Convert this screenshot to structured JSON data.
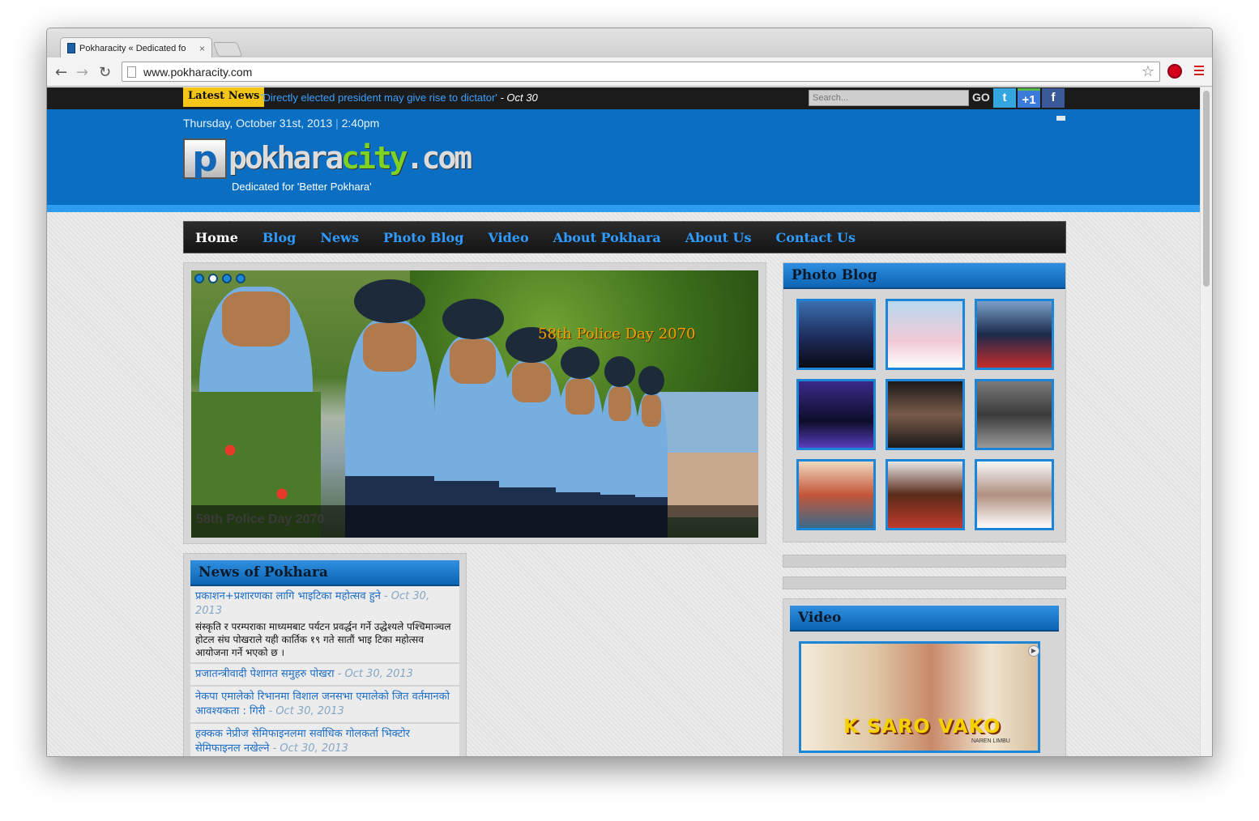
{
  "browser": {
    "tab_title": "Pokharacity « Dedicated fo",
    "tab_close": "×",
    "url": "www.pokharacity.com",
    "back": "←",
    "forward": "→",
    "reload": "↻",
    "star": "☆"
  },
  "topbar": {
    "latest_label": "Latest News",
    "latest_headline": "'Directly elected president may give rise to dictator'",
    "latest_date": "- Oct 30",
    "search_placeholder": "Search...",
    "go_label": "GO",
    "twitter": "t",
    "gplus": "+1",
    "facebook": "f"
  },
  "header": {
    "date": "Thursday, October 31st, 2013",
    "separator": "|",
    "time": "2:40pm",
    "logo_letter": "p",
    "logo_part1": "pokhara",
    "logo_part2": "city",
    "logo_part3": ".com",
    "tagline": "Dedicated for 'Better Pokhara'"
  },
  "nav": {
    "items": [
      "Home",
      "Blog",
      "News",
      "Photo Blog",
      "Video",
      "About Pokhara",
      "About Us",
      "Contact Us"
    ],
    "active": "Home"
  },
  "slider": {
    "overlay_title": "58th Police Day 2070",
    "caption": "58th Police Day 2070"
  },
  "photo_blog": {
    "title": "Photo Blog"
  },
  "video": {
    "title": "Video",
    "thumb_title": "K SARO VAKO",
    "thumb_sub": "NAREN LIMBU"
  },
  "news": {
    "title": "News of Pokhara",
    "items": [
      {
        "title": "प्रकाशन+प्रशारणका लागि भाइटिका महोत्सव हुने",
        "date": "- Oct 30, 2013",
        "excerpt": "संस्कृति र परम्पराका माध्यमबाट पर्यटन प्रवर्द्धन गर्ने उद्धेश्यले पश्चिमाञ्चल होटल संघ पोखराले यही कार्तिक १९ गते सातौं भाइ टिका महोत्सव आयोजना गर्ने भएको छ ।"
      },
      {
        "title": "प्रजातन्त्रीवादी पेशागत समुहरु पोखरा",
        "date": "- Oct 30, 2013"
      },
      {
        "title": "नेकपा एमालेको रिभानमा विशाल जनसभा एमालेको जित वर्तमानको आवश्यकता : गिरी",
        "date": "- Oct 30, 2013"
      },
      {
        "title": "हक्कक नेप्रीज सेमिफाइनलमा सर्वाधिक गोलकर्ता भिक्टोर सेमिफाइनल नखेल्ने",
        "date": "- Oct 30, 2013"
      }
    ]
  }
}
